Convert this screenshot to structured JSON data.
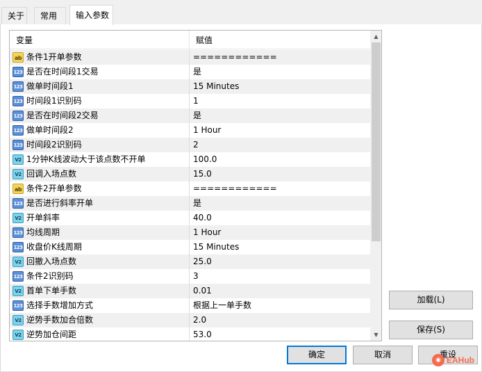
{
  "tabs": [
    {
      "label": "关于"
    },
    {
      "label": "常用"
    },
    {
      "label": "输入参数"
    }
  ],
  "active_tab": "输入参数",
  "grid": {
    "columns": [
      "变量",
      "赋值"
    ],
    "rows": [
      {
        "name": "条件1开单参数",
        "value": "============",
        "type": "ab"
      },
      {
        "name": "是否在时间段1交易",
        "value": "是",
        "type": "123"
      },
      {
        "name": "做单时间段1",
        "value": "15 Minutes",
        "type": "123"
      },
      {
        "name": "时间段1识别码",
        "value": "1",
        "type": "123"
      },
      {
        "name": "是否在时间段2交易",
        "value": "是",
        "type": "123"
      },
      {
        "name": "做单时间段2",
        "value": "1 Hour",
        "type": "123"
      },
      {
        "name": "时间段2识别码",
        "value": "2",
        "type": "123"
      },
      {
        "name": "1分钟K线波动大于该点数不开单",
        "value": "100.0",
        "type": "v12"
      },
      {
        "name": "回调入场点数",
        "value": "15.0",
        "type": "v12"
      },
      {
        "name": "条件2开单参数",
        "value": "============",
        "type": "ab"
      },
      {
        "name": "是否进行斜率开单",
        "value": "是",
        "type": "123"
      },
      {
        "name": "开单斜率",
        "value": "40.0",
        "type": "v12"
      },
      {
        "name": "均线周期",
        "value": "1 Hour",
        "type": "123"
      },
      {
        "name": "收盘价K线周期",
        "value": "15 Minutes",
        "type": "123"
      },
      {
        "name": "回撤入场点数",
        "value": "25.0",
        "type": "v12"
      },
      {
        "name": "条件2识别码",
        "value": "3",
        "type": "123"
      },
      {
        "name": "首单下单手数",
        "value": "0.01",
        "type": "v12"
      },
      {
        "name": "选择手数增加方式",
        "value": "根据上一单手数",
        "type": "123"
      },
      {
        "name": "逆势手数加合倍数",
        "value": "2.0",
        "type": "v12"
      },
      {
        "name": "逆势加仓间距",
        "value": "53.0",
        "type": "v12"
      }
    ]
  },
  "icon_labels": {
    "ab": "ab",
    "123": "123",
    "v12": "V2"
  },
  "buttons": {
    "load": "加载(L)",
    "save": "保存(S)",
    "ok": "确定",
    "cancel": "取消",
    "reset": "重设"
  },
  "watermark": {
    "text": "EAHub"
  },
  "colors": {
    "accent": "#0078d7",
    "row_alt": "#f0f0f0",
    "scroll_thumb": "#cdcdcd"
  }
}
